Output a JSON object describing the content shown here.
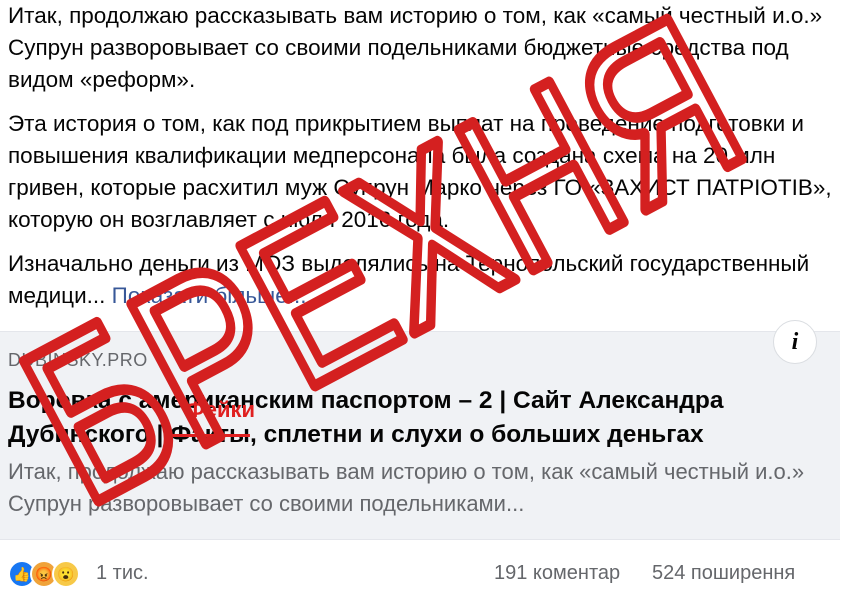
{
  "post": {
    "paragraph1": "Итак, продолжаю рассказывать вам историю о том, как «самый честный и.о.» Супрун разворовывает со своими подельниками бюджетные средства под видом «реформ».",
    "paragraph2": "Эта история о том, как под прикрытием выплат на проведение подготовки и повышения квалификации медперсонала была создана схема на 20 млн гривен, которые расхитил муж Супрун Марко через ГО «ЗАХИСТ ПАТРІОТІВ», которую он возглавляет с июля 2016 года.",
    "paragraph3": "Изначально деньги из МОЗ выделялись на Тернопольский государственный медици...",
    "see_more": "Показати більше..."
  },
  "link_card": {
    "domain": "DUBINSKY.PRO",
    "title_part1": "Воровка с американским паспортом – 2 | Сайт Александра Дубинского | ",
    "title_struck": "Факты",
    "title_part2": ", сплетни и слухи о больших деньгах",
    "description": "Итак, продолжаю рассказывать вам историю о том, как «самый честный и.о.» Супрун разворовывает со своими подельниками...",
    "info_glyph": "i"
  },
  "overlay": {
    "stamp_text": "БРЕХНЯ",
    "replacement_word": "Фейки",
    "stamp_color": "#d42020"
  },
  "footer": {
    "reactions": [
      {
        "name": "like-icon",
        "glyph": "👍"
      },
      {
        "name": "angry-icon",
        "glyph": "😡"
      },
      {
        "name": "wow-icon",
        "glyph": "😮"
      }
    ],
    "reaction_count": "1 тис.",
    "comments": "191 коментар",
    "shares": "524 поширення"
  }
}
